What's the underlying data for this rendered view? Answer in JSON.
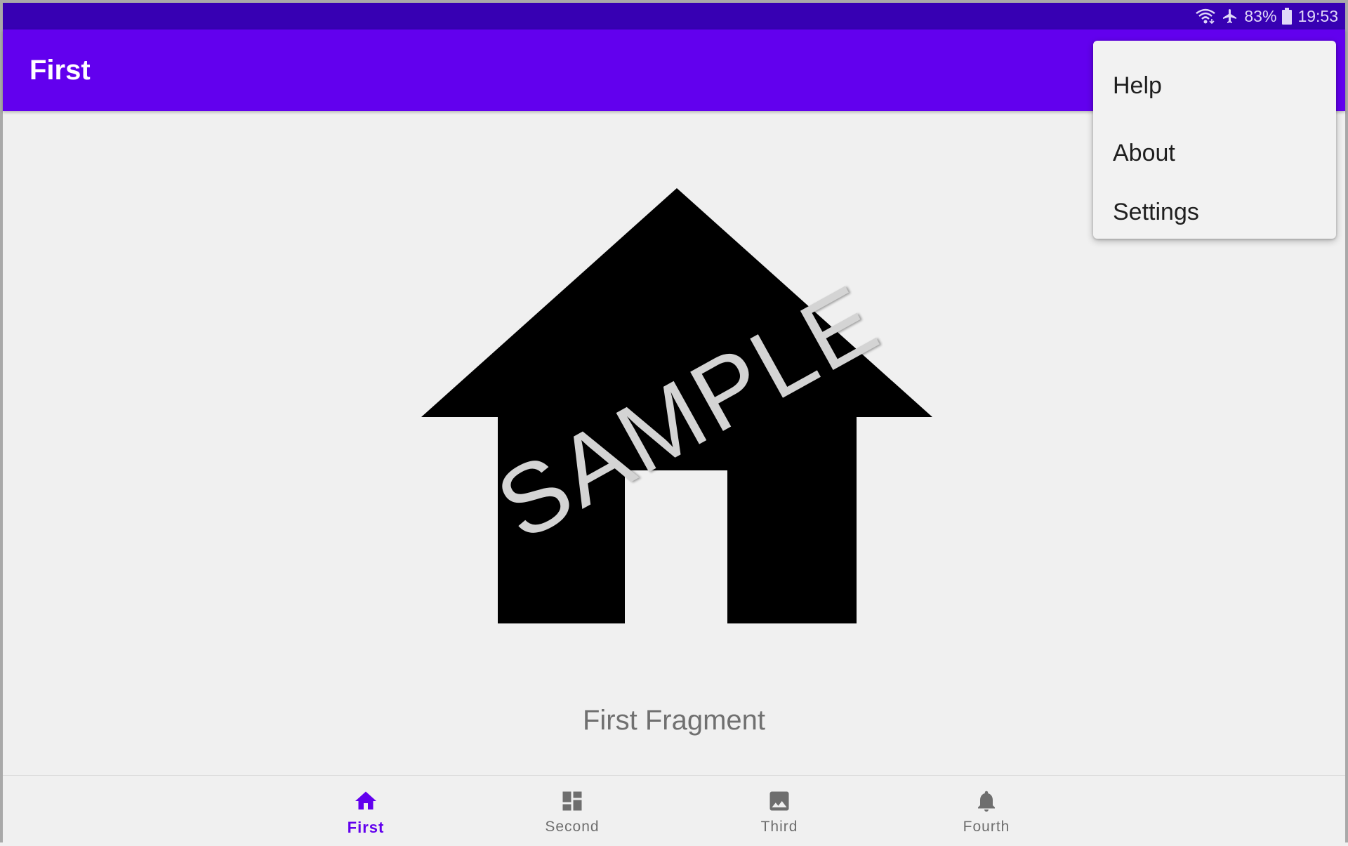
{
  "status_bar": {
    "battery": "83%",
    "time": "19:53",
    "icons": [
      "wifi-icon",
      "airplane-icon",
      "battery-icon"
    ]
  },
  "app_bar": {
    "title": "First"
  },
  "overflow_menu": {
    "items": [
      {
        "label": "Help"
      },
      {
        "label": "About"
      },
      {
        "label": "Settings"
      }
    ]
  },
  "content": {
    "icon": "home-icon",
    "watermark": "SAMPLE",
    "fragment_label": "First Fragment"
  },
  "bottom_nav": {
    "items": [
      {
        "label": "First",
        "icon": "home-icon",
        "active": true
      },
      {
        "label": "Second",
        "icon": "dashboard-icon",
        "active": false
      },
      {
        "label": "Third",
        "icon": "image-icon",
        "active": false
      },
      {
        "label": "Fourth",
        "icon": "bell-icon",
        "active": false
      }
    ]
  },
  "colors": {
    "primary": "#6200ee",
    "primary_dark": "#3700b3",
    "inactive": "#6e6e6e",
    "background": "#f0f0f0"
  }
}
